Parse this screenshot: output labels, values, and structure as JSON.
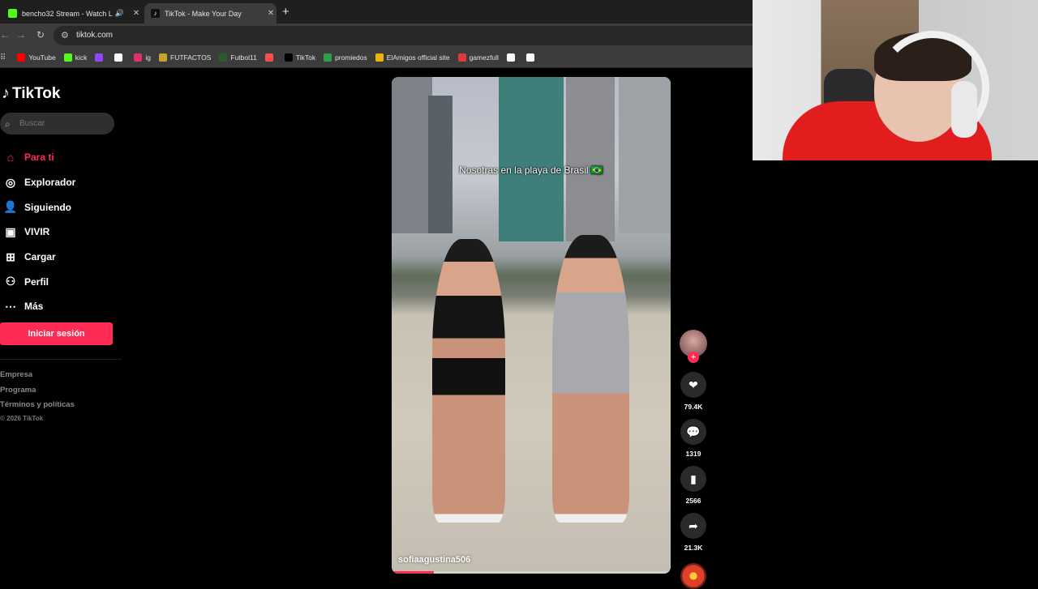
{
  "browser": {
    "tabs": [
      {
        "title": "bencho32 Stream - Watch L",
        "favicon_color": "#53fc18",
        "audio": true
      },
      {
        "title": "TikTok - Make Your Day",
        "favicon_color": "#000000",
        "active": true
      }
    ],
    "new_tab_label": "+",
    "url": "tiktok.com",
    "bookmarks": [
      {
        "label": "YouTube",
        "icon": "youtube-icon",
        "color": "#ff0000"
      },
      {
        "label": "kick",
        "icon": "kick-icon",
        "color": "#53fc18"
      },
      {
        "label": "",
        "icon": "twitch-icon",
        "color": "#9146ff"
      },
      {
        "label": "",
        "icon": "x-icon",
        "color": "#ffffff"
      },
      {
        "label": "ig",
        "icon": "instagram-icon",
        "color": "#e1306c"
      },
      {
        "label": "FUTFACTOS",
        "icon": "futfactos-icon",
        "color": "#c8a32e"
      },
      {
        "label": "Futbol11",
        "icon": "futbol11-icon",
        "color": "#2b5a2b"
      },
      {
        "label": "",
        "icon": "mail-icon",
        "color": "#ff4d4d"
      },
      {
        "label": "TikTok",
        "icon": "tiktok-icon",
        "color": "#000000"
      },
      {
        "label": "promiedos",
        "icon": "promiedos-icon",
        "color": "#2ea043"
      },
      {
        "label": "ElAmigos official site",
        "icon": "elamigos-icon",
        "color": "#f0b400"
      },
      {
        "label": "gamezfull",
        "icon": "gamezfull-icon",
        "color": "#e03b3b"
      },
      {
        "label": "",
        "icon": "diamond-icon",
        "color": "#ffffff"
      },
      {
        "label": "",
        "icon": "seventy-six-icon",
        "color": "#ffffff"
      }
    ]
  },
  "tiktok": {
    "logo": "TikTok",
    "search_placeholder": "Buscar",
    "nav": [
      {
        "label": "Para ti",
        "icon": "home-icon",
        "active": true
      },
      {
        "label": "Explorador",
        "icon": "compass-icon"
      },
      {
        "label": "Siguiendo",
        "icon": "following-icon"
      },
      {
        "label": "VIVIR",
        "icon": "live-icon"
      },
      {
        "label": "Cargar",
        "icon": "upload-icon"
      },
      {
        "label": "Perfil",
        "icon": "profile-icon"
      },
      {
        "label": "Más",
        "icon": "more-icon"
      }
    ],
    "login_label": "Iniciar sesión",
    "footer": [
      "Empresa",
      "Programa",
      "Términos y políticas"
    ],
    "copyright": "© 2026 TikTok",
    "video": {
      "caption": "Nosotras en la playa de Brasil 🇧🇷",
      "username": "sofiaagustina506",
      "progress": 0.15
    },
    "actions": {
      "likes": "79.4K",
      "comments": "1319",
      "saves": "2566",
      "shares": "21.3K"
    }
  },
  "colors": {
    "accent": "#fe2c55",
    "background": "#000000"
  }
}
